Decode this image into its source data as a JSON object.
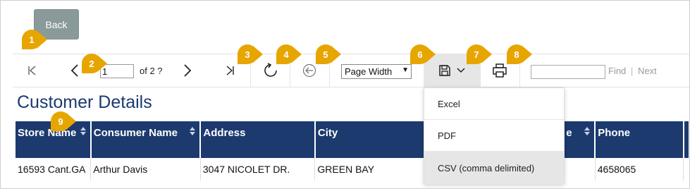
{
  "back": {
    "label": "Back"
  },
  "toolbar": {
    "page_value": "1",
    "page_of": "of 2 ?",
    "zoom_value": "Page Width",
    "find_label": "Find",
    "find_sep": "|",
    "next_label": "Next"
  },
  "export_menu": {
    "options": [
      "Excel",
      "PDF",
      "CSV (comma delimited)"
    ],
    "highlighted": "CSV (comma delimited)"
  },
  "report": {
    "title": "Customer Details"
  },
  "table": {
    "headers": [
      "Store Name",
      "Consumer Name",
      "Address",
      "City",
      "e",
      "Phone",
      ""
    ],
    "rows": [
      [
        "16593 Cant.GA",
        "Arthur Davis",
        "3047 NICOLET DR.",
        "GREEN BAY",
        "",
        "4658065",
        ""
      ]
    ]
  },
  "callouts": [
    "1",
    "2",
    "3",
    "4",
    "5",
    "6",
    "7",
    "8",
    "9"
  ],
  "colors": {
    "accent": "#1c3a6e",
    "title": "#1a3a70",
    "badge": "#e7a500",
    "back_button": "#8a9a9a"
  }
}
